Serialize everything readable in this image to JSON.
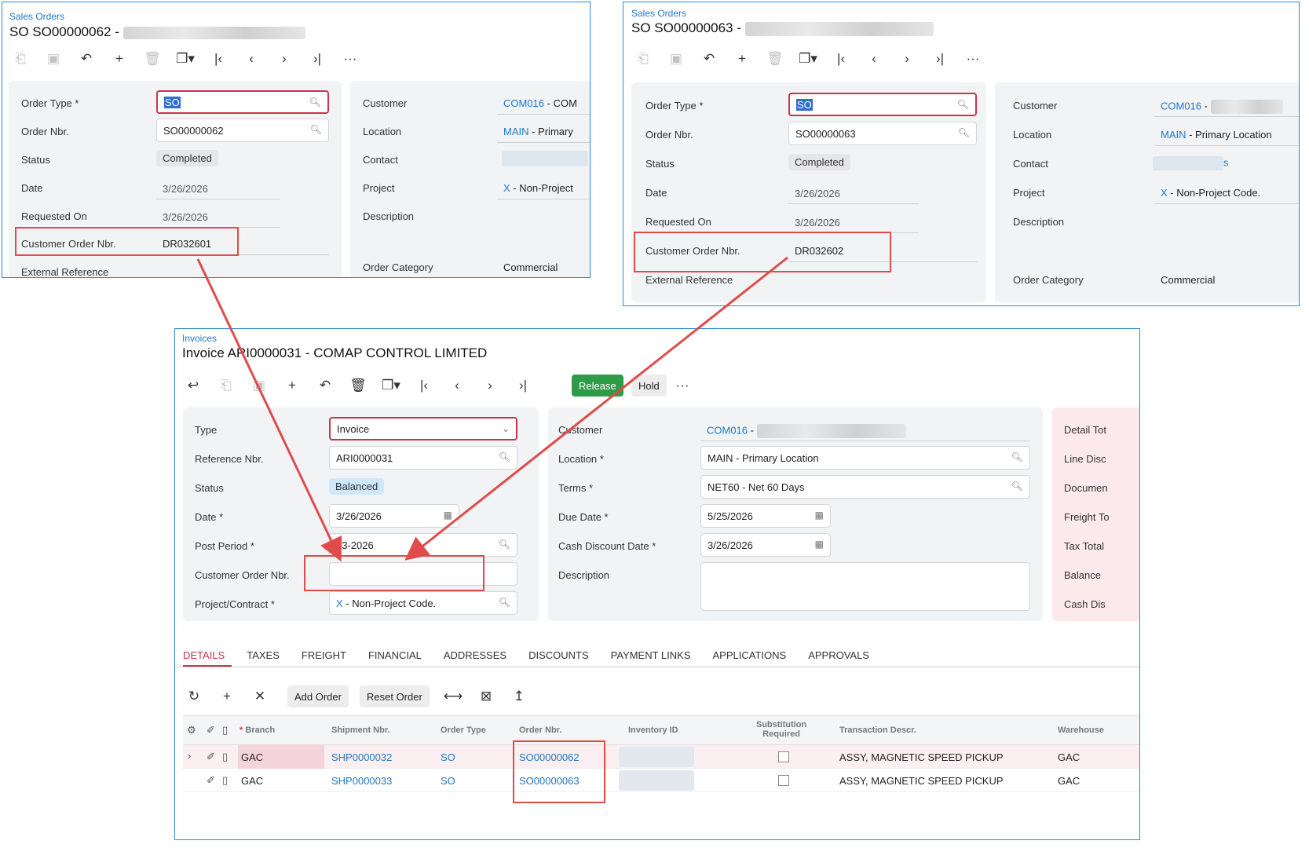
{
  "so1": {
    "breadcrumb": "Sales Orders",
    "title": "SO SO00000062 -",
    "order_type_label": "Order Type *",
    "order_type_value": "SO",
    "order_nbr_label": "Order Nbr.",
    "order_nbr_value": "SO00000062",
    "status_label": "Status",
    "status_value": "Completed",
    "date_label": "Date",
    "date_value": "3/26/2026",
    "requested_on_label": "Requested On",
    "requested_on_value": "3/26/2026",
    "customer_order_nbr_label": "Customer Order Nbr.",
    "customer_order_nbr_value": "DR032601",
    "external_ref_label": "External Reference",
    "customer_label": "Customer",
    "customer_value": "COM016",
    "customer_suffix": " - COM",
    "location_label": "Location",
    "location_code": "MAIN",
    "location_desc": " - Primary",
    "contact_label": "Contact",
    "project_label": "Project",
    "project_code": "X",
    "project_desc": " - Non-Project",
    "description_label": "Description",
    "order_category_label": "Order Category",
    "order_category_value": "Commercial"
  },
  "so2": {
    "breadcrumb": "Sales Orders",
    "title": "SO SO00000063 -",
    "order_type_label": "Order Type *",
    "order_type_value": "SO",
    "order_nbr_label": "Order Nbr.",
    "order_nbr_value": "SO00000063",
    "status_label": "Status",
    "status_value": "Completed",
    "date_label": "Date",
    "date_value": "3/26/2026",
    "requested_on_label": "Requested On",
    "requested_on_value": "3/26/2026",
    "customer_order_nbr_label": "Customer Order Nbr.",
    "customer_order_nbr_value": "DR032602",
    "external_ref_label": "External Reference",
    "customer_label": "Customer",
    "customer_value": "COM016",
    "customer_suffix": " -",
    "location_label": "Location",
    "location_code": "MAIN",
    "location_desc": " - Primary Location",
    "contact_label": "Contact",
    "contact_tail": "s",
    "project_label": "Project",
    "project_code": "X",
    "project_desc": " - Non-Project Code.",
    "description_label": "Description",
    "order_category_label": "Order Category",
    "order_category_value": "Commercial"
  },
  "invoice": {
    "breadcrumb": "Invoices",
    "title": "Invoice ARI0000031 - COMAP CONTROL LIMITED",
    "release_label": "Release",
    "hold_label": "Hold",
    "type_label": "Type",
    "type_value": "Invoice",
    "ref_nbr_label": "Reference Nbr.",
    "ref_nbr_value": "ARI0000031",
    "status_label": "Status",
    "status_value": "Balanced",
    "date_label": "Date *",
    "date_value": "3/26/2026",
    "post_period_label": "Post Period *",
    "post_period_value": "03-2026",
    "customer_order_nbr_label": "Customer Order Nbr.",
    "customer_order_nbr_value": "",
    "project_label": "Project/Contract *",
    "project_code": "X",
    "project_desc": " - Non-Project Code.",
    "customer_label": "Customer",
    "customer_value": "COM016",
    "customer_suffix": " -",
    "location_label": "Location *",
    "location_value": "MAIN - Primary Location",
    "terms_label": "Terms *",
    "terms_value": "NET60 - Net 60 Days",
    "due_date_label": "Due Date *",
    "due_date_value": "5/25/2026",
    "cash_disc_date_label": "Cash Discount Date *",
    "cash_disc_date_value": "3/26/2026",
    "description_label": "Description",
    "totals": [
      "Detail Tot",
      "Line Disc",
      "Documen",
      "Freight To",
      "Tax Total",
      "Balance",
      "Cash Dis"
    ],
    "tabs": [
      "DETAILS",
      "TAXES",
      "FREIGHT",
      "FINANCIAL",
      "ADDRESSES",
      "DISCOUNTS",
      "PAYMENT LINKS",
      "APPLICATIONS",
      "APPROVALS"
    ],
    "add_order_label": "Add Order",
    "reset_order_label": "Reset Order",
    "grid_headers": {
      "branch": "Branch",
      "shipment": "Shipment Nbr.",
      "order_type": "Order Type",
      "order_nbr": "Order Nbr.",
      "inventory": "Inventory ID",
      "substitution_1": "Substitution",
      "substitution_2": "Required",
      "descr": "Transaction Descr.",
      "warehouse": "Warehouse"
    },
    "rows": [
      {
        "branch": "GAC",
        "shipment": "SHP0000032",
        "order_type": "SO",
        "order_nbr": "SO00000062",
        "descr": "ASSY, MAGNETIC SPEED PICKUP",
        "warehouse": "GAC"
      },
      {
        "branch": "GAC",
        "shipment": "SHP0000033",
        "order_type": "SO",
        "order_nbr": "SO00000063",
        "descr": "ASSY, MAGNETIC SPEED PICKUP",
        "warehouse": "GAC"
      }
    ]
  },
  "colors": {
    "link": "#1f77c9",
    "panel_border": "#2b87d8",
    "annotation_red": "#e04b4b",
    "active_tab": "#c8344d",
    "release_green": "#2e9b48",
    "balanced_badge": "#cfe7fb",
    "completed_badge": "#e6e6e6"
  }
}
